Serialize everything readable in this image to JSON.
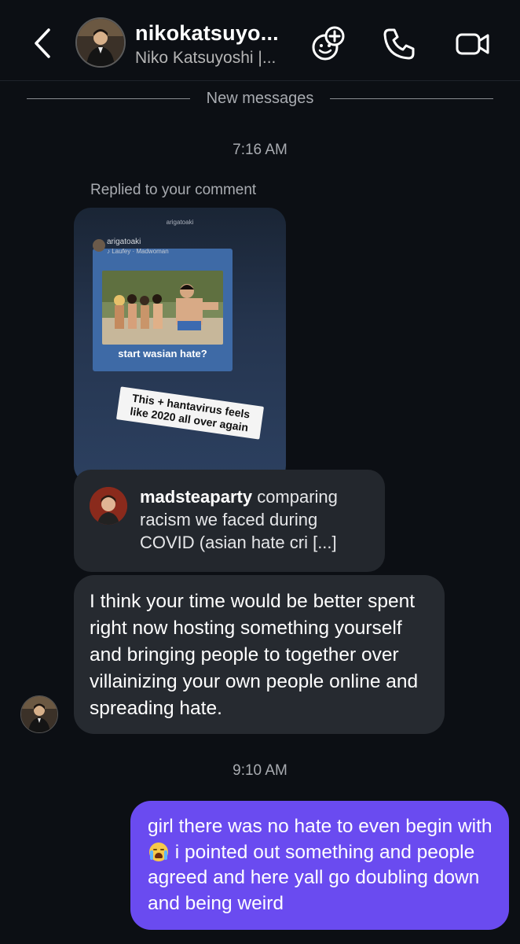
{
  "header": {
    "username": "nikokatsuyo...",
    "subtitle": "Niko Katsuyoshi |...",
    "icons": [
      "back-arrow",
      "sticker-face-add",
      "phone",
      "video-camera"
    ]
  },
  "divider": {
    "label": "New messages"
  },
  "timestamps": {
    "first": "7:16 AM",
    "second": "9:10 AM"
  },
  "reply": {
    "label": "Replied to your comment",
    "story": {
      "top_username": "arigatoaki",
      "header_username": "arigatoaki",
      "music": "♪ Laufey · Madwoman",
      "caption": "start wasian hate?",
      "sticker": "This + hantavirus feels like 2020 all over again"
    },
    "quoted_comment": {
      "username": "madsteaparty",
      "text": " comparing racism we faced during COVID (asian hate cri [...]"
    }
  },
  "messages": {
    "incoming": "I think your time would be better spent right now hosting something yourself and bringing people to together over villainizing your own people online and spreading hate.",
    "outgoing_part1": "girl there was no hate to even begin with",
    "outgoing_emoji": "loudly-crying-face",
    "outgoing_part2": " i pointed out something and people agreed and here yall go doubling down and being weird"
  },
  "colors": {
    "background": "#0c0f14",
    "incoming_bubble": "#262a30",
    "outgoing_bubble": "#6a4bf0",
    "muted_text": "#a8abb0"
  }
}
